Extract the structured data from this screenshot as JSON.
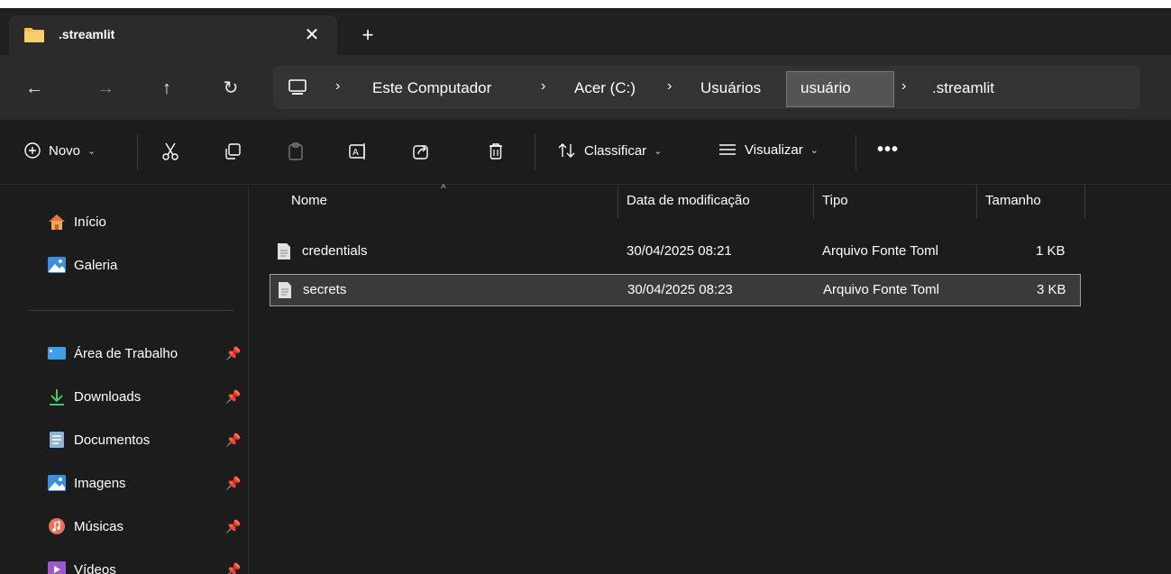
{
  "tab": {
    "title": ".streamlit",
    "close_glyph": "✕",
    "new_tab_glyph": "+"
  },
  "nav": {
    "back": "←",
    "forward": "→",
    "up": "↑",
    "refresh": "↻",
    "breadcrumbs": [
      "Este Computador",
      "Acer (C:)",
      "Usuários",
      "usuário",
      ".streamlit"
    ],
    "separator": "›"
  },
  "toolbar": {
    "new_label": "Novo",
    "sort_label": "Classificar",
    "view_label": "Visualizar",
    "more_glyph": "•••",
    "chevron": "⌄"
  },
  "sidebar": {
    "items": [
      {
        "label": "Início",
        "icon": "home-icon"
      },
      {
        "label": "Galeria",
        "icon": "gallery-icon"
      },
      {
        "label": "Área de Trabalho",
        "icon": "desktop-icon",
        "pinned": true
      },
      {
        "label": "Downloads",
        "icon": "download-icon",
        "pinned": true
      },
      {
        "label": "Documentos",
        "icon": "documents-icon",
        "pinned": true
      },
      {
        "label": "Imagens",
        "icon": "pictures-icon",
        "pinned": true
      },
      {
        "label": "Músicas",
        "icon": "music-icon",
        "pinned": true
      },
      {
        "label": "Vídeos",
        "icon": "videos-icon",
        "pinned": true
      }
    ],
    "pin_glyph": "📌"
  },
  "files": {
    "columns": [
      "Nome",
      "Data de modificação",
      "Tipo",
      "Tamanho"
    ],
    "rows": [
      {
        "name": "credentials",
        "modified": "30/04/2025 08:21",
        "type": "Arquivo Fonte Toml",
        "size": "1 KB",
        "selected": false
      },
      {
        "name": "secrets",
        "modified": "30/04/2025 08:23",
        "type": "Arquivo Fonte Toml",
        "size": "3 KB",
        "selected": true
      }
    ],
    "sort_caret": "^"
  },
  "colors": {
    "window_bg": "#1c1c1c",
    "tab_bg": "#2b2b2b",
    "folder_yellow": "#f2c14e",
    "accent_blue": "#3b8fe0"
  }
}
